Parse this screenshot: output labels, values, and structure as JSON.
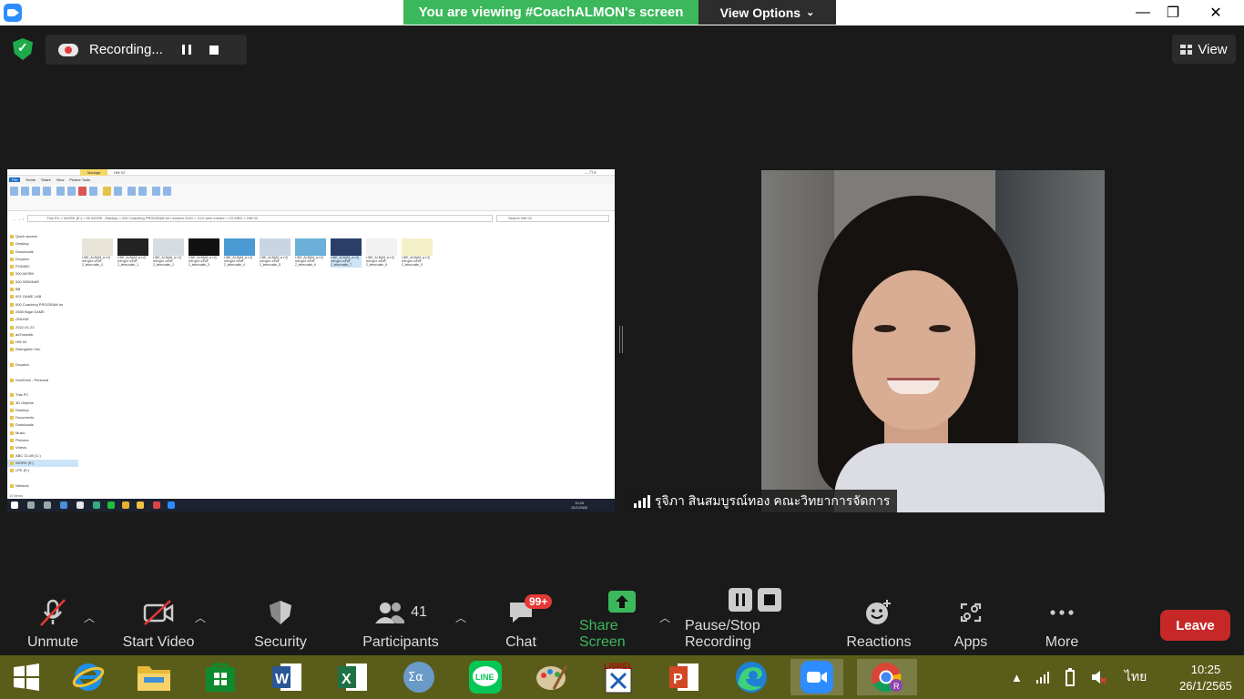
{
  "banner": {
    "viewing_text": "You are viewing #CoachALMON's screen",
    "view_options_label": "View Options"
  },
  "recording": {
    "label": "Recording..."
  },
  "view_button": {
    "label": "View"
  },
  "participant": {
    "name": "รุจิภา สินสมบูรณ์ทอง คณะวิทยาการจัดการ"
  },
  "toolbar": {
    "unmute": "Unmute",
    "start_video": "Start Video",
    "security": "Security",
    "participants": "Participants",
    "participants_count": "41",
    "chat": "Chat",
    "chat_badge": "99+",
    "share_screen": "Share Screen",
    "pause_stop": "Pause/Stop Recording",
    "reactions": "Reactions",
    "apps": "Apps",
    "more": "More",
    "leave": "Leave",
    "share_color": "#3cb85c",
    "leave_color": "#c62828"
  },
  "explorer": {
    "tabs": [
      "File",
      "Home",
      "Share",
      "View",
      "Picture Tools"
    ],
    "manage_tab": "Manage",
    "window_title": "HW 02",
    "address": "This PC  >  WORK (E:)  >  00 WORK - Backup  >  000 Coaching PROGRAM for Lecturer 2021  >  XXX.sem enbare  >  03 WED  >  HW 02",
    "search_placeholder": "Search HW 02",
    "nav_items": [
      "Quick access",
      "Desktop",
      "Downloads",
      "Dropbox",
      "PODMIC",
      "000 WORK",
      "000 SEMINAR",
      "BB",
      "001 GAME LAB",
      "000 Coaching PROGRAM for",
      "2565 Bigai GAME",
      "ONLINE",
      "2022-01-23",
      "ad7nwinbk",
      "HW 02",
      "Strengthen Yeu",
      "",
      "Dropbox",
      "",
      "OneDrive - Personal",
      "",
      "This PC",
      "3D Objects",
      "Desktop",
      "Documents",
      "Downloads",
      "Music",
      "Pictures",
      "Videos",
      "ABC CLUB (C:)",
      "WORK (E:)",
      "LPE (E:)",
      "",
      "Network"
    ],
    "files": [
      {
        "name": "LINE_ALBUM_ควรรู้หลักสูตร ครั้งที่ 2_lebecoaltn_0",
        "color": "#e8e4d8"
      },
      {
        "name": "LINE_ALBUM_ควรรู้หลักสูตร ครั้งที่ 2_lebecoaltn_1",
        "color": "#222222"
      },
      {
        "name": "LINE_ALBUM_ควรรู้หลักสูตร ครั้งที่ 2_lebecoaltn_2",
        "color": "#d6dde0"
      },
      {
        "name": "LINE_ALBUM_ควรรู้หลักสูตร ครั้งที่ 2_lebecoaltn_3",
        "color": "#111111"
      },
      {
        "name": "LINE_ALBUM_ควรรู้หลักสูตร ครั้งที่ 2_lebecoaltn_4",
        "color": "#4a9ad4"
      },
      {
        "name": "LINE_ALBUM_ควรรู้หลักสูตร ครั้งที่ 2_lebecoaltn_5",
        "color": "#c9d4e4"
      },
      {
        "name": "LINE_ALBUM_ควรรู้หลักสูตร ครั้งที่ 2_lebecoaltn_6",
        "color": "#6ab0d8"
      },
      {
        "name": "LINE_ALBUM_ควรรู้หลักสูตร ครั้งที่ 2_lebecoaltn_7",
        "color": "#2a3e6a"
      },
      {
        "name": "LINE_ALBUM_ควรรู้หลักสูตร ครั้งที่ 2_lebecoaltn_8",
        "color": "#f2f2f2"
      },
      {
        "name": "LINE_ALBUM_ควรรู้หลักสูตร ครั้งที่ 2_lebecoaltn_9",
        "color": "#f4f0c8"
      }
    ],
    "status": "10 items",
    "time": "10:25",
    "date": "26/1/2565"
  },
  "taskbar": {
    "apps": [
      "start",
      "internet-explorer",
      "file-explorer",
      "store",
      "word",
      "excel",
      "math-input",
      "line",
      "paint",
      "lisrel",
      "powerpoint",
      "edge",
      "zoom",
      "chrome"
    ],
    "language": "ไทย",
    "time": "10:25",
    "date": "26/1/2565"
  }
}
